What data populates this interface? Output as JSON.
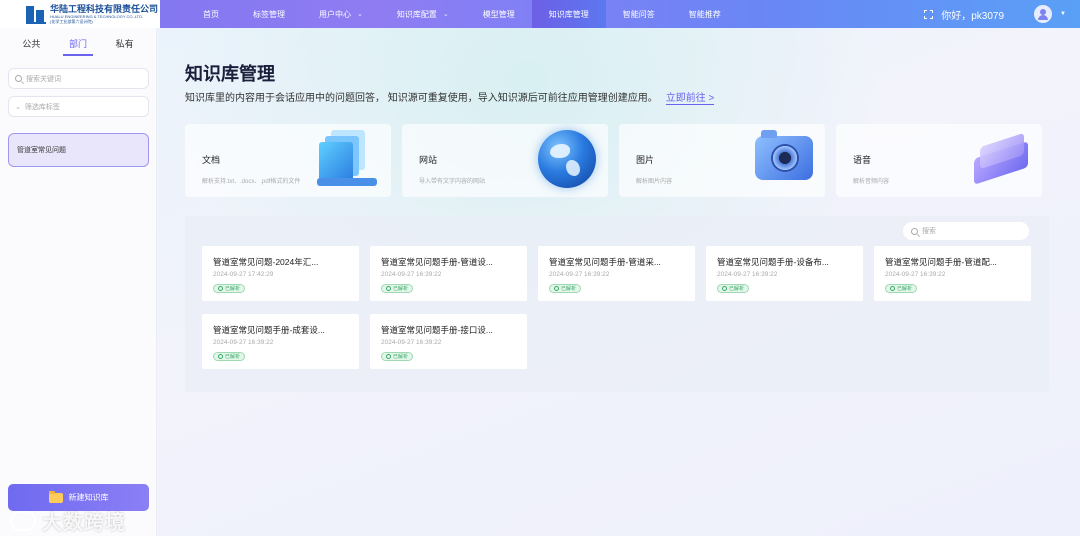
{
  "header": {
    "logo_cn": "华陆工程科技有限责任公司",
    "logo_en": "HUALU ENGINEERING & TECHNOLOGY CO.,LTD.",
    "logo_sub": "(化学工业部第六设计院)",
    "nav": [
      {
        "label": "首页"
      },
      {
        "label": "标签管理"
      },
      {
        "label": "用户中心",
        "chevron": "chevron-down"
      },
      {
        "label": "知识库配置",
        "chevron": "chevron-down"
      },
      {
        "label": "模型管理"
      },
      {
        "label": "知识库管理",
        "active": true
      },
      {
        "label": "智能问答"
      },
      {
        "label": "智能推荐"
      }
    ],
    "greeting": "你好，pk3079"
  },
  "sidebar": {
    "tabs": [
      "公共",
      "部门",
      "私有"
    ],
    "active_tab": "部门",
    "search_placeholder": "搜索关键词",
    "filter_placeholder": "筛选库标签",
    "kb_items": [
      "管道室常见问题"
    ],
    "new_button": "新建知识库"
  },
  "main": {
    "title": "知识库管理",
    "description": "知识库里的内容用于会话应用中的问题回答， 知识源可重复使用，导入知识源后可前往应用管理创建应用。",
    "goto_link": "立即前往 >",
    "source_cards": [
      {
        "title": "文档",
        "desc": "解析支持.txt、.docx、.pdf格式的文件",
        "icon": "document-stack-icon"
      },
      {
        "title": "网站",
        "desc": "导入带有文字内容的网站",
        "icon": "globe-icon"
      },
      {
        "title": "图片",
        "desc": "解析图片内容",
        "icon": "camera-icon"
      },
      {
        "title": "语音",
        "desc": "解析音频内容",
        "icon": "audio-icon"
      }
    ],
    "search_placeholder": "搜索",
    "documents": [
      {
        "title": "管道室常见问题-2024年汇...",
        "time": "2024-09-27 17:42:29",
        "status": "已解析"
      },
      {
        "title": "管道室常见问题手册-管道设...",
        "time": "2024-09-27 16:39:22",
        "status": "已解析"
      },
      {
        "title": "管道室常见问题手册-管道采...",
        "time": "2024-09-27 16:39:22",
        "status": "已解析"
      },
      {
        "title": "管道室常见问题手册-设备布...",
        "time": "2024-09-27 16:39:22",
        "status": "已解析"
      },
      {
        "title": "管道室常见问题手册-管道配...",
        "time": "2024-09-27 16:39:22",
        "status": "已解析"
      },
      {
        "title": "管道室常见问题手册-成套设...",
        "time": "2024-09-27 16:39:22",
        "status": "已解析"
      },
      {
        "title": "管道室常见问题手册-接口设...",
        "time": "2024-09-27 16:39:22",
        "status": "已解析"
      }
    ]
  },
  "watermark": "大数跨境",
  "colors": {
    "accent": "#6a63ee",
    "parsed": "#3aa865"
  }
}
